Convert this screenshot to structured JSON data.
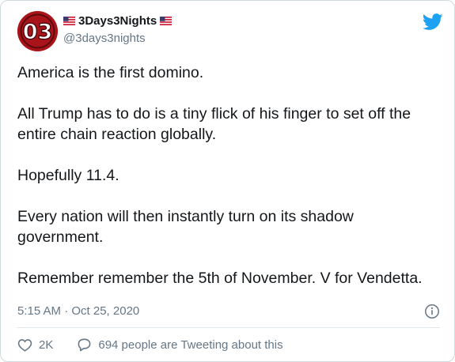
{
  "tweet": {
    "author": {
      "display_name": "3Days3Nights",
      "handle": "@3days3nights",
      "avatar_text": "03",
      "flag_icon": "us-flag-icon"
    },
    "brand_icon": "twitter-bird-icon",
    "paragraphs": [
      "America is the first domino.",
      "All Trump has to do is a tiny flick of his finger to set off the entire chain reaction globally.",
      "Hopefully 11.4.",
      "Every nation will then instantly turn on its shadow government.",
      "Remember remember the 5th of November. V for Vendetta."
    ],
    "timestamp": "5:15 AM · Oct 25, 2020",
    "info_icon": "info-icon",
    "actions": {
      "like_count": "2K",
      "like_icon": "heart-icon",
      "conversation_text": "694 people are Tweeting about this",
      "conversation_icon": "chat-bubble-icon"
    }
  },
  "colors": {
    "text_primary": "#14171a",
    "text_secondary": "#657786",
    "twitter_blue": "#1da1f2",
    "avatar_red": "#b3151b",
    "border": "#cfd9de"
  }
}
